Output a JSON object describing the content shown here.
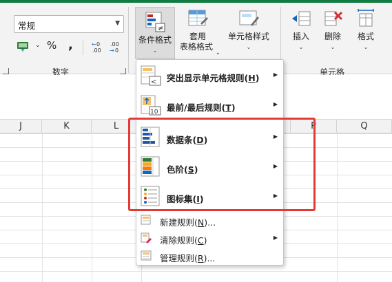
{
  "ribbon": {
    "number_format_value": "常规",
    "currency_symbol": "¥",
    "percent_symbol": "%",
    "comma_symbol": ",",
    "number_group_label": "数字",
    "cells_group_label": "单元格",
    "conditional_format": "条件格式",
    "table_format_line1": "套用",
    "table_format_line2": "表格格式",
    "cell_styles": "单元格样式",
    "insert": "插入",
    "delete": "删除",
    "format": "格式"
  },
  "columns": [
    "J",
    "K",
    "L",
    "P",
    "Q"
  ],
  "menu": {
    "items": [
      {
        "label": "突出显示单元格规则(H)",
        "text": "突出显示单元格规则(",
        "key": "H",
        "tail": ")",
        "icon": "highlight-rules-icon",
        "submenu": true
      },
      {
        "label": "最前/最后规则(T)",
        "text": "最前/最后规则(",
        "key": "T",
        "tail": ")",
        "icon": "top-bottom-rules-icon",
        "submenu": true
      },
      {
        "label": "数据条(D)",
        "text": "数据条(",
        "key": "D",
        "tail": ")",
        "icon": "data-bars-icon",
        "submenu": true
      },
      {
        "label": "色阶(S)",
        "text": "色阶(",
        "key": "S",
        "tail": ")",
        "icon": "color-scales-icon",
        "submenu": true
      },
      {
        "label": "图标集(I)",
        "text": "图标集(",
        "key": "I",
        "tail": ")",
        "icon": "icon-sets-icon",
        "submenu": true
      },
      {
        "label": "新建规则(N)...",
        "text": "新建规则(",
        "key": "N",
        "tail": ")...",
        "icon": "new-rule-icon",
        "submenu": false
      },
      {
        "label": "清除规则(C)",
        "text": "清除规则(",
        "key": "C",
        "tail": ")",
        "icon": "clear-rules-icon",
        "submenu": true
      },
      {
        "label": "管理规则(R)...",
        "text": "管理规则(",
        "key": "R",
        "tail": ")...",
        "icon": "manage-rules-icon",
        "submenu": false
      }
    ],
    "icon_mini_labels": {
      "highlight": "<",
      "top_bottom": "10"
    }
  }
}
